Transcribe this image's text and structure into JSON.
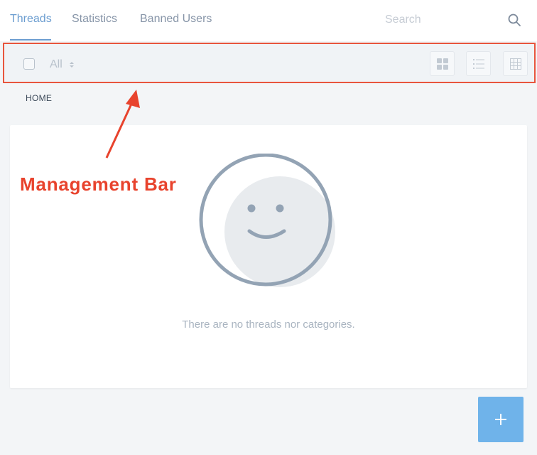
{
  "nav": {
    "tabs": [
      {
        "label": "Threads",
        "active": true
      },
      {
        "label": "Statistics",
        "active": false
      },
      {
        "label": "Banned Users",
        "active": false
      }
    ],
    "search_placeholder": "Search"
  },
  "management_bar": {
    "filter_label": "All",
    "view_modes": [
      "cards-icon",
      "list-icon",
      "table-icon"
    ]
  },
  "breadcrumb": {
    "label": "HOME"
  },
  "empty_state": {
    "message": "There are no threads nor categories."
  },
  "annotation": {
    "label": "Management Bar"
  },
  "add_button": {
    "label": "+"
  },
  "colors": {
    "accent": "#6b9dd0",
    "annotation": "#e8432d",
    "add_button": "#6fb3ea"
  }
}
